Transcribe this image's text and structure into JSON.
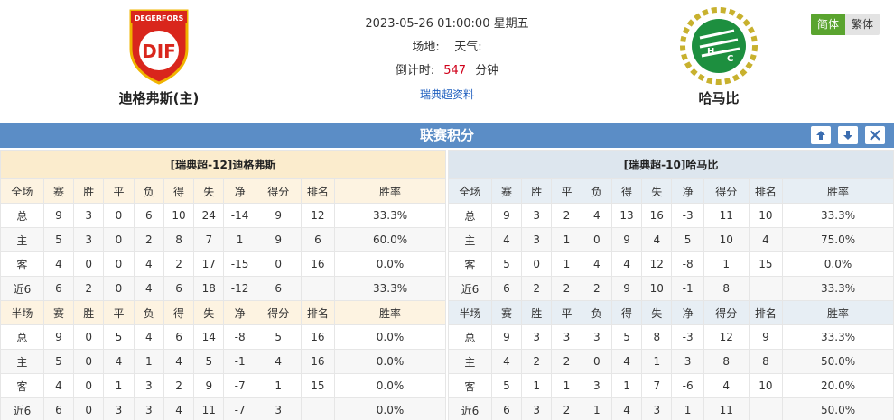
{
  "home": {
    "name": "迪格弗斯(主)",
    "logo_text": "DEGERFORS"
  },
  "away": {
    "name": "哈马比"
  },
  "match": {
    "datetime": "2023-05-26 01:00:00 星期五",
    "venue_label": "场地:",
    "weather_label": "天气:",
    "countdown_label": "倒计时:",
    "countdown_value": "547",
    "countdown_unit": "分钟",
    "league_link": "瑞典超资料"
  },
  "lang": {
    "simplified": "简体",
    "traditional": "繁体"
  },
  "section_title": "联赛积分",
  "colors": {
    "accent_bar": "#5b8dc6",
    "home_highlight": "#d0021b",
    "away_highlight": "#1f3fbf"
  },
  "standings": {
    "left": {
      "title": "[瑞典超-12]迪格弗斯",
      "full": {
        "header": [
          "全场",
          "赛",
          "胜",
          "平",
          "负",
          "得",
          "失",
          "净",
          "得分",
          "排名",
          "胜率"
        ],
        "rows": [
          [
            "总",
            "9",
            "3",
            "0",
            "6",
            "10",
            "24",
            "-14",
            "9",
            "12",
            "33.3%"
          ],
          [
            "主",
            "5",
            "3",
            "0",
            "2",
            "8",
            "7",
            "1",
            "9",
            "6",
            "60.0%"
          ],
          [
            "客",
            "4",
            "0",
            "0",
            "4",
            "2",
            "17",
            "-15",
            "0",
            "16",
            "0.0%"
          ],
          [
            "近6",
            "6",
            "2",
            "0",
            "4",
            "6",
            "18",
            "-12",
            "6",
            "",
            "33.3%"
          ]
        ]
      },
      "half": {
        "header": [
          "半场",
          "赛",
          "胜",
          "平",
          "负",
          "得",
          "失",
          "净",
          "得分",
          "排名",
          "胜率"
        ],
        "rows": [
          [
            "总",
            "9",
            "0",
            "5",
            "4",
            "6",
            "14",
            "-8",
            "5",
            "16",
            "0.0%"
          ],
          [
            "主",
            "5",
            "0",
            "4",
            "1",
            "4",
            "5",
            "-1",
            "4",
            "16",
            "0.0%"
          ],
          [
            "客",
            "4",
            "0",
            "1",
            "3",
            "2",
            "9",
            "-7",
            "1",
            "15",
            "0.0%"
          ],
          [
            "近6",
            "6",
            "0",
            "3",
            "3",
            "4",
            "11",
            "-7",
            "3",
            "",
            "0.0%"
          ]
        ]
      }
    },
    "right": {
      "title": "[瑞典超-10]哈马比",
      "full": {
        "header": [
          "全场",
          "赛",
          "胜",
          "平",
          "负",
          "得",
          "失",
          "净",
          "得分",
          "排名",
          "胜率"
        ],
        "rows": [
          [
            "总",
            "9",
            "3",
            "2",
            "4",
            "13",
            "16",
            "-3",
            "11",
            "10",
            "33.3%"
          ],
          [
            "主",
            "4",
            "3",
            "1",
            "0",
            "9",
            "4",
            "5",
            "10",
            "4",
            "75.0%"
          ],
          [
            "客",
            "5",
            "0",
            "1",
            "4",
            "4",
            "12",
            "-8",
            "1",
            "15",
            "0.0%"
          ],
          [
            "近6",
            "6",
            "2",
            "2",
            "2",
            "9",
            "10",
            "-1",
            "8",
            "",
            "33.3%"
          ]
        ]
      },
      "half": {
        "header": [
          "半场",
          "赛",
          "胜",
          "平",
          "负",
          "得",
          "失",
          "净",
          "得分",
          "排名",
          "胜率"
        ],
        "rows": [
          [
            "总",
            "9",
            "3",
            "3",
            "3",
            "5",
            "8",
            "-3",
            "12",
            "9",
            "33.3%"
          ],
          [
            "主",
            "4",
            "2",
            "2",
            "0",
            "4",
            "1",
            "3",
            "8",
            "8",
            "50.0%"
          ],
          [
            "客",
            "5",
            "1",
            "1",
            "3",
            "1",
            "7",
            "-6",
            "4",
            "10",
            "20.0%"
          ],
          [
            "近6",
            "6",
            "3",
            "2",
            "1",
            "4",
            "3",
            "1",
            "11",
            "",
            "50.0%"
          ]
        ]
      }
    }
  }
}
